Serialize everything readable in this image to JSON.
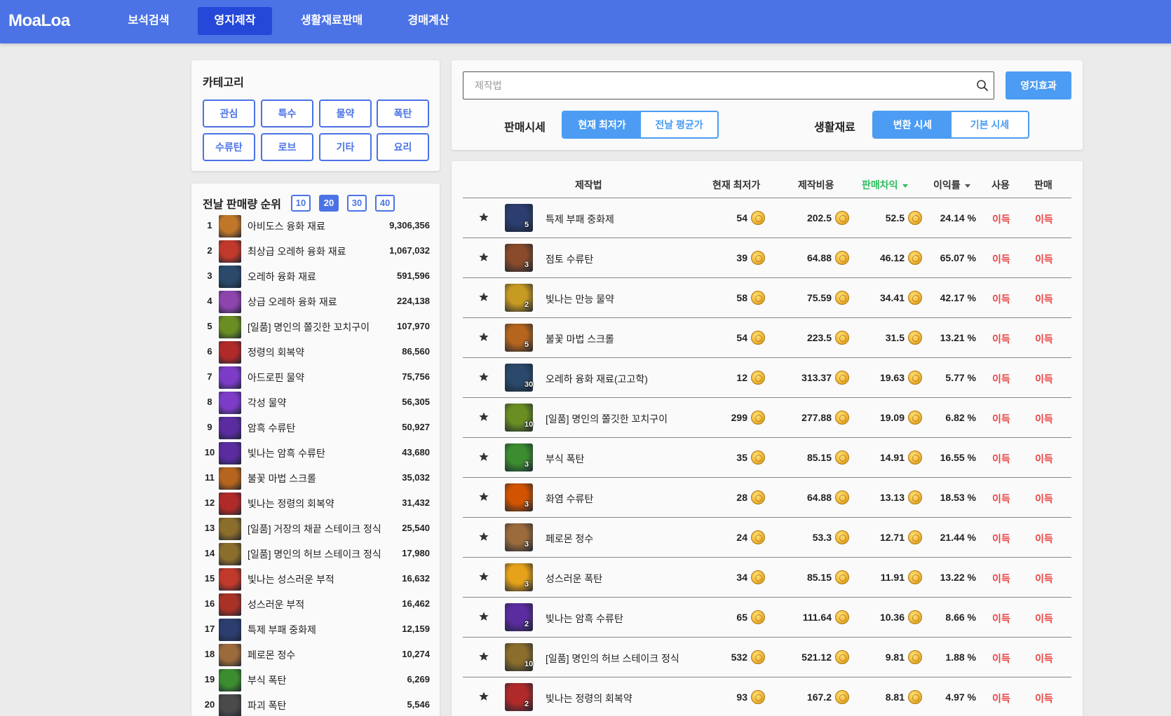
{
  "app": {
    "logo": "MoaLoa"
  },
  "nav": [
    {
      "label": "보석검색",
      "active": false
    },
    {
      "label": "영지제작",
      "active": true
    },
    {
      "label": "생활재료판매",
      "active": false
    },
    {
      "label": "경매계산",
      "active": false
    }
  ],
  "category": {
    "title": "카테고리",
    "buttons": [
      "관심",
      "특수",
      "물약",
      "폭탄",
      "수류탄",
      "로브",
      "기타",
      "요리"
    ]
  },
  "ranking": {
    "title": "전날 판매량 순위",
    "toggles": [
      "10",
      "20",
      "30",
      "40"
    ],
    "active_toggle": "20",
    "rows": [
      {
        "rank": "1",
        "name": "아비도스 융화 재료",
        "count": "9,306,356",
        "icon_color": "#c0772a"
      },
      {
        "rank": "2",
        "name": "최상급 오레하 융화 재료",
        "count": "1,067,032",
        "icon_color": "#c0392b"
      },
      {
        "rank": "3",
        "name": "오레하 융화 재료",
        "count": "591,596",
        "icon_color": "#2b4a6b"
      },
      {
        "rank": "4",
        "name": "상급 오레하 융화 재료",
        "count": "224,138",
        "icon_color": "#8e44ad"
      },
      {
        "rank": "5",
        "name": "[일품] 명인의 쫄깃한 꼬치구이",
        "count": "107,970",
        "icon_color": "#6b8e23"
      },
      {
        "rank": "6",
        "name": "정령의 회복약",
        "count": "86,560",
        "icon_color": "#b02a2a"
      },
      {
        "rank": "7",
        "name": "아드로핀 물약",
        "count": "75,756",
        "icon_color": "#7d3cc8"
      },
      {
        "rank": "8",
        "name": "각성 물약",
        "count": "56,305",
        "icon_color": "#7d3cc8"
      },
      {
        "rank": "9",
        "name": "암흑 수류탄",
        "count": "50,927",
        "icon_color": "#5b2ca0"
      },
      {
        "rank": "10",
        "name": "빛나는 암흑 수류탄",
        "count": "43,680",
        "icon_color": "#5b2ca0"
      },
      {
        "rank": "11",
        "name": "불꽃 마법 스크롤",
        "count": "35,032",
        "icon_color": "#b5651d"
      },
      {
        "rank": "12",
        "name": "빛나는 정령의 회복약",
        "count": "31,432",
        "icon_color": "#b02a2a"
      },
      {
        "rank": "13",
        "name": "[일품] 거장의 채끝 스테이크 정식",
        "count": "25,540",
        "icon_color": "#8b6d2c"
      },
      {
        "rank": "14",
        "name": "[일품] 명인의 허브 스테이크 정식",
        "count": "17,980",
        "icon_color": "#8b6d2c"
      },
      {
        "rank": "15",
        "name": "빛나는 성스러운 부적",
        "count": "16,632",
        "icon_color": "#c0392b"
      },
      {
        "rank": "16",
        "name": "성스러운 부적",
        "count": "16,462",
        "icon_color": "#a93226"
      },
      {
        "rank": "17",
        "name": "특제 부패 중화제",
        "count": "12,159",
        "icon_color": "#2c3e70"
      },
      {
        "rank": "18",
        "name": "페로몬 정수",
        "count": "10,274",
        "icon_color": "#9c6b3c"
      },
      {
        "rank": "19",
        "name": "부식 폭탄",
        "count": "6,269",
        "icon_color": "#3c8d2f"
      },
      {
        "rank": "20",
        "name": "파괴 폭탄",
        "count": "5,546",
        "icon_color": "#4a4a4a"
      }
    ]
  },
  "search": {
    "placeholder": "제작법",
    "effect_button": "영지효과",
    "sell_price_label": "판매시세",
    "sell_price_options": [
      "현재 최저가",
      "전날 평균가"
    ],
    "sell_price_active": "현재 최저가",
    "material_label": "생활재료",
    "material_options": [
      "변환 시세",
      "기본 시세"
    ],
    "material_active": "변환 시세"
  },
  "table": {
    "headers": {
      "recipe": "제작법",
      "current_price": "현재 최저가",
      "cost": "제작비용",
      "profit": "판매차익",
      "margin": "이익률",
      "use": "사용",
      "sell": "판매"
    },
    "rows": [
      {
        "name": "특제 부패 중화제",
        "qty": "5",
        "price": "54",
        "cost": "202.5",
        "profit": "52.5",
        "margin": "24.14 %",
        "use": "이득",
        "sell": "이득",
        "icon_color": "#2c3e70"
      },
      {
        "name": "점토 수류탄",
        "qty": "3",
        "price": "39",
        "cost": "64.88",
        "profit": "46.12",
        "margin": "65.07 %",
        "use": "이득",
        "sell": "이득",
        "icon_color": "#8a4b2a"
      },
      {
        "name": "빛나는 만능 물약",
        "qty": "2",
        "price": "58",
        "cost": "75.59",
        "profit": "34.41",
        "margin": "42.17 %",
        "use": "이득",
        "sell": "이득",
        "icon_color": "#c79a22"
      },
      {
        "name": "불꽃 마법 스크롤",
        "qty": "5",
        "price": "54",
        "cost": "223.5",
        "profit": "31.5",
        "margin": "13.21 %",
        "use": "이득",
        "sell": "이득",
        "icon_color": "#b5651d"
      },
      {
        "name": "오레하 융화 재료(고고학)",
        "qty": "30",
        "price": "12",
        "cost": "313.37",
        "profit": "19.63",
        "margin": "5.77 %",
        "use": "이득",
        "sell": "이득",
        "icon_color": "#2b4a6b"
      },
      {
        "name": "[일품] 명인의 쫄깃한 꼬치구이",
        "qty": "10",
        "price": "299",
        "cost": "277.88",
        "profit": "19.09",
        "margin": "6.82 %",
        "use": "이득",
        "sell": "이득",
        "icon_color": "#6b8e23"
      },
      {
        "name": "부식 폭탄",
        "qty": "3",
        "price": "35",
        "cost": "85.15",
        "profit": "14.91",
        "margin": "16.55 %",
        "use": "이득",
        "sell": "이득",
        "icon_color": "#3c8d2f"
      },
      {
        "name": "화염 수류탄",
        "qty": "3",
        "price": "28",
        "cost": "64.88",
        "profit": "13.13",
        "margin": "18.53 %",
        "use": "이득",
        "sell": "이득",
        "icon_color": "#d35400"
      },
      {
        "name": "페로몬 정수",
        "qty": "3",
        "price": "24",
        "cost": "53.3",
        "profit": "12.71",
        "margin": "21.44 %",
        "use": "이득",
        "sell": "이득",
        "icon_color": "#9c6b3c"
      },
      {
        "name": "성스러운 폭탄",
        "qty": "3",
        "price": "34",
        "cost": "85.15",
        "profit": "11.91",
        "margin": "13.22 %",
        "use": "이득",
        "sell": "이득",
        "icon_color": "#e6a21a"
      },
      {
        "name": "빛나는 암흑 수류탄",
        "qty": "2",
        "price": "65",
        "cost": "111.64",
        "profit": "10.36",
        "margin": "8.66 %",
        "use": "이득",
        "sell": "이득",
        "icon_color": "#5b2ca0"
      },
      {
        "name": "[일품] 명인의 허브 스테이크 정식",
        "qty": "10",
        "price": "532",
        "cost": "521.12",
        "profit": "9.81",
        "margin": "1.88 %",
        "use": "이득",
        "sell": "이득",
        "icon_color": "#8b6d2c"
      },
      {
        "name": "빛나는 정령의 회복약",
        "qty": "2",
        "price": "93",
        "cost": "167.2",
        "profit": "8.81",
        "margin": "4.97 %",
        "use": "이득",
        "sell": "이득",
        "icon_color": "#b02a2a"
      }
    ]
  }
}
